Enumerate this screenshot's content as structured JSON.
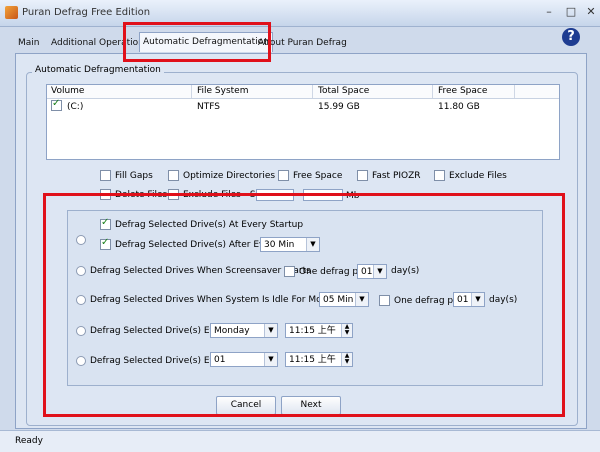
{
  "window": {
    "title": "Puran Defrag Free Edition"
  },
  "tabs": [
    {
      "label": "Main"
    },
    {
      "label": "Additional Operations"
    },
    {
      "label": "Automatic Defragmentation"
    },
    {
      "label": "About Puran Defrag"
    }
  ],
  "help": {
    "label": "?"
  },
  "group": {
    "title": "Automatic Defragmentation"
  },
  "table": {
    "columns": [
      "Volume",
      "File System",
      "Total Space",
      "Free Space"
    ],
    "rows": [
      {
        "volume": "(C:)",
        "fs": "NTFS",
        "total": "15.99 GB",
        "free": "11.80 GB",
        "checked": true
      }
    ]
  },
  "options": {
    "fill_gaps": "Fill Gaps",
    "optimize_dirs": "Optimize Directories",
    "free_space": "Free Space",
    "fast_piozr": "Fast PIOZR",
    "exclude_files": "Exclude Files",
    "delete_files": "Delete Files",
    "exclude_files_size": "Exclude Files - Size",
    "mb": "Mb",
    "dash": "-"
  },
  "schedule": {
    "at_startup": "Defrag Selected Drive(s) At Every Startup",
    "after_every": "Defrag Selected Drive(s) After Every",
    "after_every_value": "30 Min",
    "screensaver": "Defrag Selected Drives When Screensaver Starts",
    "one_defrag_per": "One defrag per",
    "days": "day(s)",
    "per_value1": "01",
    "idle": "Defrag Selected Drives When System Is Idle For More Than",
    "idle_value": "05 Min",
    "per_value2": "01",
    "every_weekday": "Defrag Selected Drive(s) Every",
    "weekday_value": "Monday",
    "time1": "11:15 上午",
    "every_day": "Defrag Selected Drive(s) Every",
    "day_value": "01",
    "time2": "11:15 上午"
  },
  "buttons": {
    "cancel": "Cancel",
    "next": "Next"
  },
  "status": {
    "text": "Ready"
  }
}
